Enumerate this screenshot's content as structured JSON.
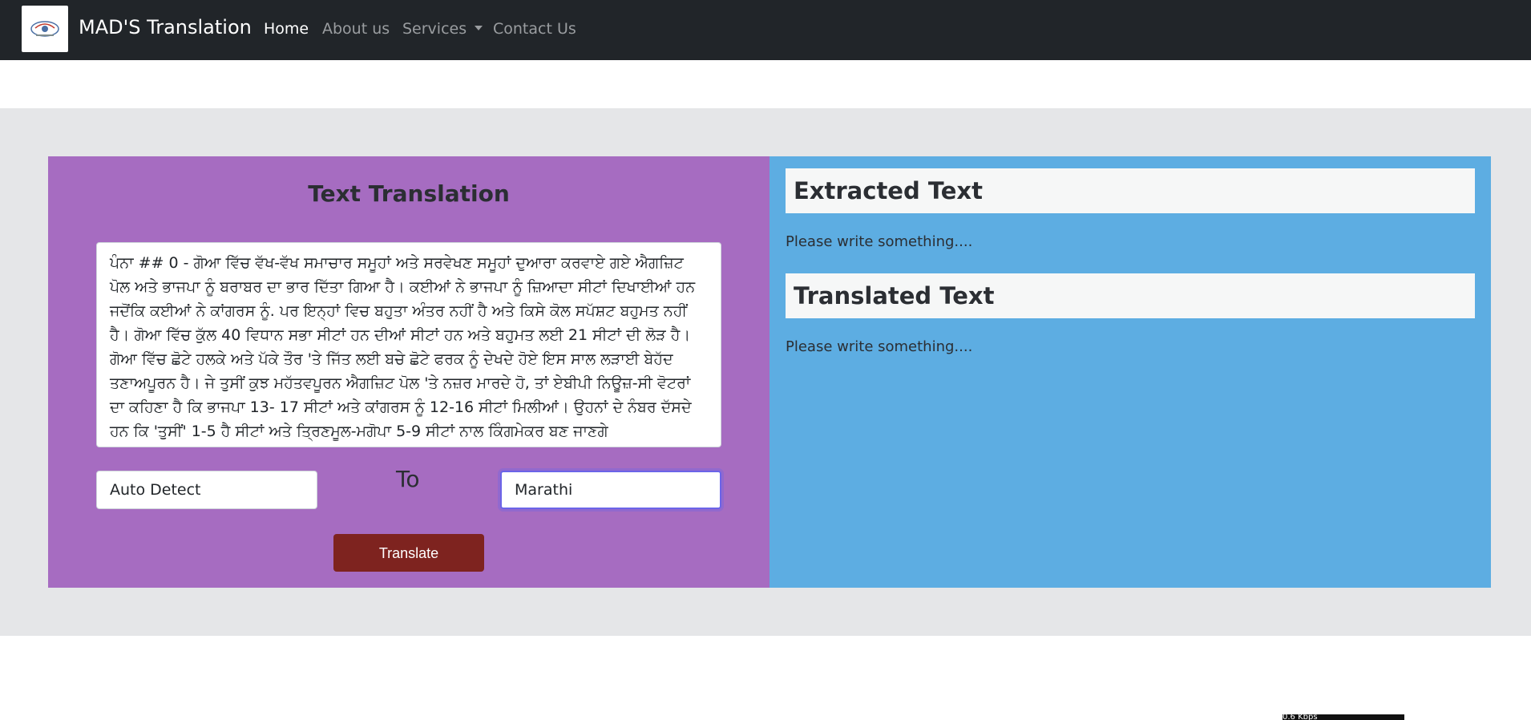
{
  "navbar": {
    "brand": "MAD'S Translation",
    "links": [
      {
        "label": "Home",
        "active": true
      },
      {
        "label": "About us"
      },
      {
        "label": "Services"
      },
      {
        "label": "Contact Us"
      }
    ],
    "services_icon": "caret-down-icon"
  },
  "translator": {
    "title": "Text Translation",
    "source_text": "ਪੰਨਾ ## 0 - ਗੋਆ ਵਿੱਚ ਵੱਖ-ਵੱਖ ਸਮਾਚਾਰ ਸਮੂਹਾਂ ਅਤੇ ਸਰਵੇਖਣ ਸਮੂਹਾਂ ਦੁਆਰਾ ਕਰਵਾਏ ਗਏ ਐਗਜ਼ਿਟ ਪੋਲ ਅਤੇ ਭਾਜਪਾ ਨੂੰ ਬਰਾਬਰ ਦਾ ਭਾਰ ਦਿੱਤਾ ਗਿਆ ਹੈ। ਕਈਆਂ ਨੇ ਭਾਜਪਾ ਨੂੰ ਜ਼ਿਆਦਾ ਸੀਟਾਂ ਦਿਖਾਈਆਂ ਹਨ ਜਦੋਂਕਿ ਕਈਆਂ ਨੇ ਕਾਂਗਰਸ ਨੂੰ. ਪਰ ਇਨ੍ਹਾਂ ਵਿਚ ਬਹੁਤਾ ਅੰਤਰ ਨਹੀਂ ਹੈ ਅਤੇ ਕਿਸੇ ਕੋਲ ਸਪੱਸ਼ਟ ਬਹੁਮਤ ਨਹੀਂ ਹੈ। ਗੋਆ ਵਿੱਚ ਕੁੱਲ 40 ਵਿਧਾਨ ਸਭਾ ਸੀਟਾਂ ਹਨ ਦੀਆਂ ਸੀਟਾਂ ਹਨ ਅਤੇ ਬਹੁਮਤ ਲਈ 21 ਸੀਟਾਂ ਦੀ ਲੋੜ ਹੈ। ਗੋਆ ਵਿੱਚ ਛੋਟੇ ਹਲਕੇ ਅਤੇ ਪੱਕੇ ਤੌਰ 'ਤੇ ਜਿੱਤ ਲਈ ਬਚੇ ਛੋਟੇ ਫਰਕ ਨੂੰ ਦੇਖਦੇ ਹੋਏ ਇਸ ਸਾਲ ਲੜਾਈ ਬੇਹੱਦ ਤਣਾਅਪੂਰਨ ਹੈ। ਜੇ ਤੁਸੀਂ ਕੁਝ ਮਹੱਤਵਪੂਰਨ ਐਗਜ਼ਿਟ ਪੋਲ 'ਤੇ ਨਜ਼ਰ ਮਾਰਦੇ ਹੋ, ਤਾਂ ਏਬੀਪੀ ਨਿਊਜ਼-ਸੀ ਵੋਟਰਾਂ ਦਾ ਕਹਿਣਾ ਹੈ ਕਿ ਭਾਜਪਾ 13- 17 ਸੀਟਾਂ ਅਤੇ ਕਾਂਗਰਸ ਨੂੰ 12-16 ਸੀਟਾਂ ਮਿਲੀਆਂ। ਉਹਨਾਂ ਦੇ ਨੰਬਰ ਦੱਸਦੇ ਹਨ ਕਿ 'ਤੁਸੀਂ' 1-5 ਹੈ ਸੀਟਾਂ ਅਤੇ ਤ੍ਰਿਣਮੂਲ-ਮਗੋਪਾ 5-9 ਸੀਟਾਂ ਨਾਲ ਕਿੰਗਮੇਕਰ ਬਣ ਜਾਣਗੇ",
    "from_language": "Auto Detect",
    "to_label": "To",
    "to_language": "Marathi",
    "translate_label": "Translate"
  },
  "results": {
    "extracted_title": "Extracted Text",
    "extracted_placeholder": "Please write something....",
    "translated_title": "Translated Text",
    "translated_placeholder": "Please write something...."
  },
  "speed_badge": "0.6 Kbps",
  "colors": {
    "navbar": "#212529",
    "left_panel": "#a66cc1",
    "right_panel": "#5dade2",
    "translate_button": "#7e231f",
    "page_band": "#e5e6e8"
  }
}
